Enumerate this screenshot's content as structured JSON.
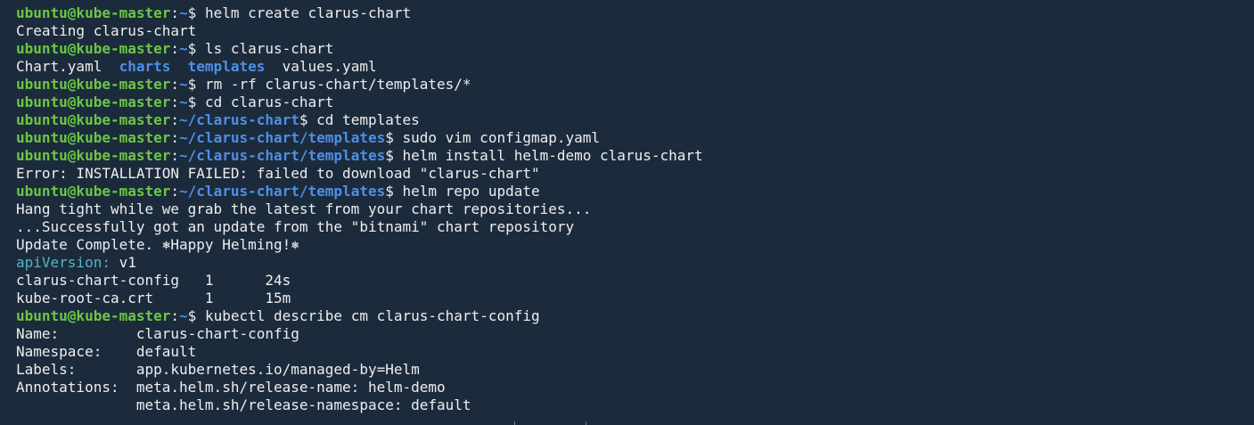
{
  "prompt": {
    "user_host": "ubuntu@kube-master",
    "sep": ":",
    "dollar": "$ "
  },
  "lines": [
    {
      "type": "prompt",
      "path": "~",
      "cmd": "helm create clarus-chart"
    },
    {
      "type": "out",
      "text": "Creating clarus-chart"
    },
    {
      "type": "prompt",
      "path": "~",
      "cmd": "ls clarus-chart"
    },
    {
      "type": "ls",
      "items": [
        {
          "text": "Chart.yaml",
          "kind": "file"
        },
        {
          "text": "  ",
          "kind": "gap"
        },
        {
          "text": "charts",
          "kind": "dir"
        },
        {
          "text": "  ",
          "kind": "gap"
        },
        {
          "text": "templates",
          "kind": "dir"
        },
        {
          "text": "  ",
          "kind": "gap"
        },
        {
          "text": "values.yaml",
          "kind": "file"
        }
      ]
    },
    {
      "type": "prompt",
      "path": "~",
      "cmd": "rm -rf clarus-chart/templates/*"
    },
    {
      "type": "prompt",
      "path": "~",
      "cmd": "cd clarus-chart"
    },
    {
      "type": "prompt",
      "path": "~/clarus-chart",
      "cmd": "cd templates"
    },
    {
      "type": "prompt",
      "path": "~/clarus-chart/templates",
      "cmd": "sudo vim configmap.yaml"
    },
    {
      "type": "prompt",
      "path": "~/clarus-chart/templates",
      "cmd": "helm install helm-demo clarus-chart"
    },
    {
      "type": "out",
      "text": "Error: INSTALLATION FAILED: failed to download \"clarus-chart\""
    },
    {
      "type": "prompt",
      "path": "~/clarus-chart/templates",
      "cmd": "helm repo update"
    },
    {
      "type": "out",
      "text": "Hang tight while we grab the latest from your chart repositories..."
    },
    {
      "type": "out",
      "text": "...Successfully got an update from the \"bitnami\" chart repository"
    },
    {
      "type": "out",
      "text": "Update Complete. ⎈Happy Helming!⎈"
    },
    {
      "type": "kv",
      "key": "apiVersion:",
      "value": " v1"
    },
    {
      "type": "out",
      "text": "clarus-chart-config   1      24s"
    },
    {
      "type": "out",
      "text": "kube-root-ca.crt      1      15m"
    },
    {
      "type": "prompt",
      "path": "~",
      "cmd": "kubectl describe cm clarus-chart-config"
    },
    {
      "type": "out",
      "text": "Name:         clarus-chart-config"
    },
    {
      "type": "out",
      "text": "Namespace:    default"
    },
    {
      "type": "out",
      "text": "Labels:       app.kubernetes.io/managed-by=Helm"
    },
    {
      "type": "out",
      "text": "Annotations:  meta.helm.sh/release-name: helm-demo"
    },
    {
      "type": "out",
      "text": "              meta.helm.sh/release-namespace: default"
    }
  ],
  "colors": {
    "background": "#1c2b3c",
    "user_host": "#6cc644",
    "path": "#4f8fe6",
    "text": "#eeeeee",
    "yaml_key": "#56b6c2"
  }
}
